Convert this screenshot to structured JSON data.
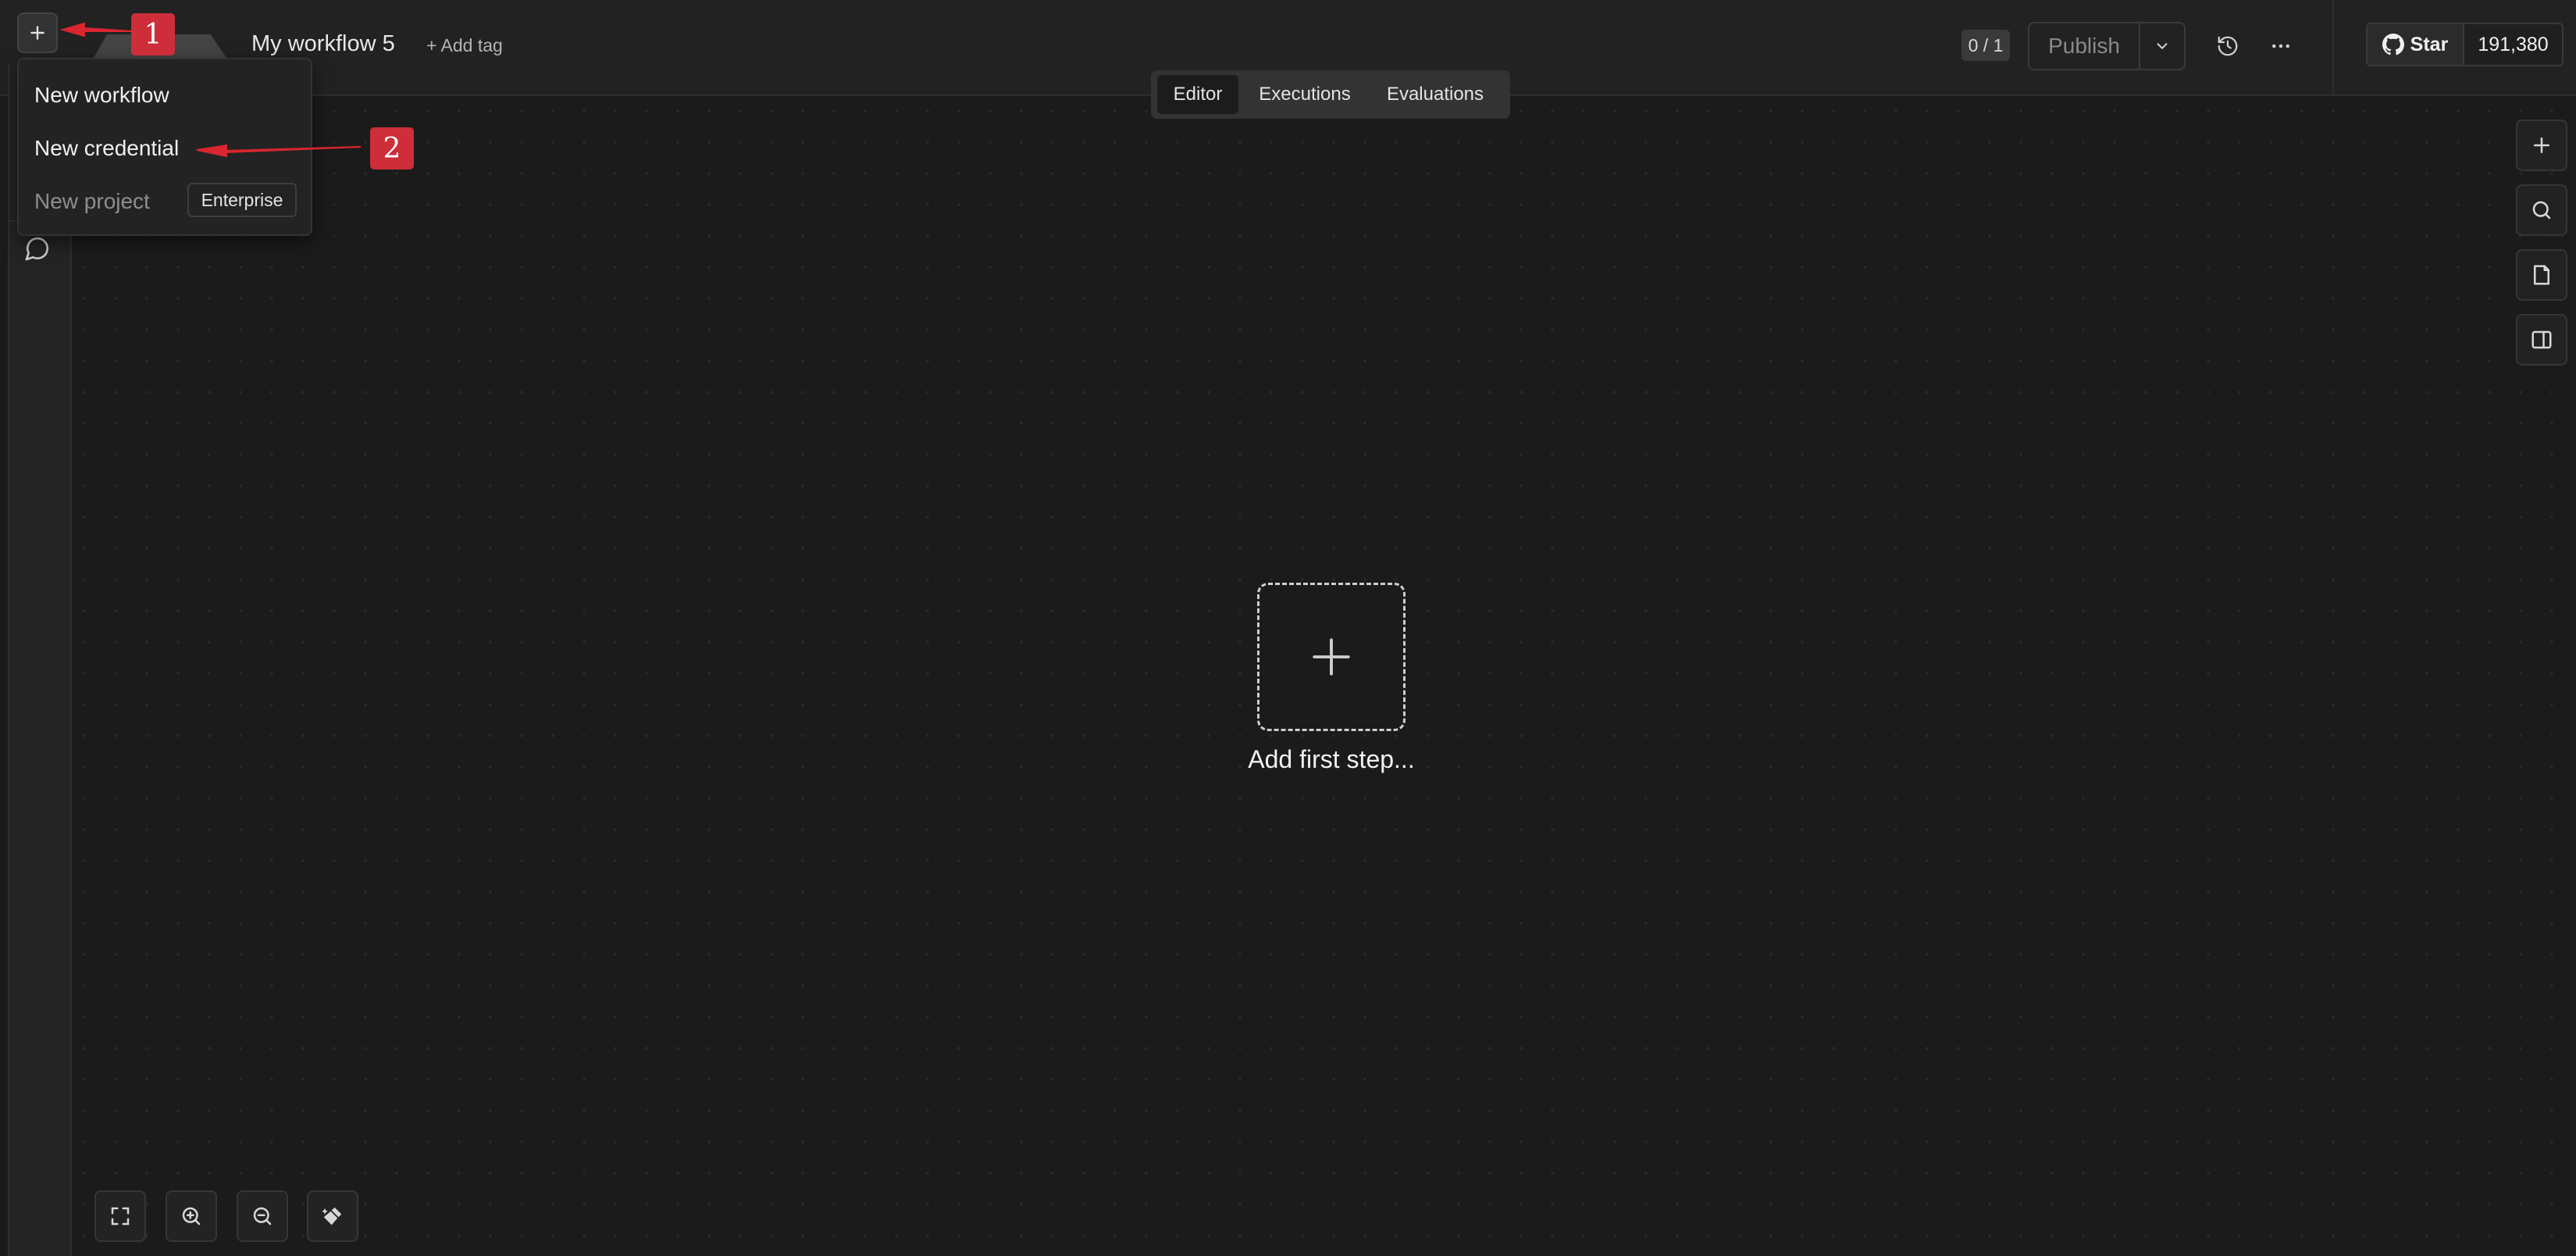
{
  "header": {
    "workflow_name": "My workflow 5",
    "add_tag_label": "+ Add tag",
    "node_counter": "0 / 1",
    "publish_label": "Publish",
    "github": {
      "star_label": "Star",
      "star_count": "191,380"
    }
  },
  "create_menu": {
    "items": [
      {
        "label": "New workflow"
      },
      {
        "label": "New credential"
      },
      {
        "label": "New project",
        "badge": "Enterprise"
      }
    ]
  },
  "view_tabs": [
    {
      "label": "Editor",
      "active": true
    },
    {
      "label": "Executions",
      "active": false
    },
    {
      "label": "Evaluations",
      "active": false
    }
  ],
  "canvas": {
    "add_first_step_label": "Add first step..."
  },
  "annotations": [
    {
      "number": "1",
      "color": "#cd2e3a"
    },
    {
      "number": "2",
      "color": "#cd2e3a"
    }
  ],
  "icons": {
    "create": "plus-icon",
    "chat": "chat-bubble-icon",
    "publish_dropdown": "chevron-down-icon",
    "history": "history-icon",
    "more": "ellipsis-icon",
    "github": "github-icon",
    "right_toolbar": [
      "plus-icon",
      "search-icon",
      "sticky-note-icon",
      "panel-toggle-icon"
    ],
    "bottom_toolbar": [
      "fit-view-icon",
      "zoom-in-icon",
      "zoom-out-icon",
      "tidy-up-icon"
    ]
  },
  "colors": {
    "background": "#1b1b1b",
    "topbar": "#222222",
    "annotation": "#cd2e3a",
    "text": "#e8e8e8"
  }
}
